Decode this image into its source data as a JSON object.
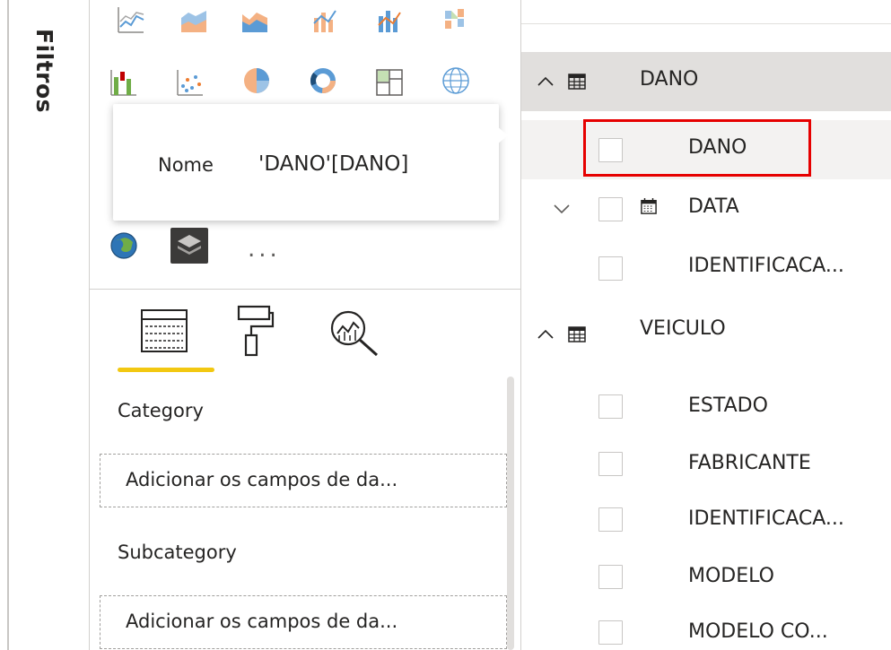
{
  "filters": {
    "label": "Filtros"
  },
  "tooltip": {
    "name_label": "Nome",
    "value": "'DANO'[DANO]"
  },
  "visualizations": {
    "more_label": "...",
    "icons_row1": [
      "line-chart-icon",
      "area-chart-icon",
      "stacked-area-chart-icon",
      "line-column-chart-icon",
      "line-stacked-column-chart-icon",
      "ribbon-chart-icon"
    ],
    "icons_row2": [
      "waterfall-chart-icon",
      "scatter-chart-icon",
      "pie-chart-icon",
      "donut-chart-icon",
      "treemap-icon",
      "map-icon"
    ],
    "icons_row3": [
      "arcgis-map-icon",
      "custom-visual-icon"
    ],
    "tabs": [
      "fields-tab",
      "format-tab",
      "analytics-tab"
    ]
  },
  "wells": [
    {
      "label": "Category",
      "placeholder": "Adicionar os campos de da..."
    },
    {
      "label": "Subcategory",
      "placeholder": "Adicionar os campos de da..."
    }
  ],
  "fields_pane": {
    "tables": [
      {
        "name": "DANO",
        "expanded": true,
        "fields": [
          {
            "name": "DANO",
            "type": "field"
          },
          {
            "name": "DATA",
            "type": "date-hierarchy",
            "expanded": false
          },
          {
            "name": "IDENTIFICACA...",
            "type": "field"
          }
        ]
      },
      {
        "name": "VEICULO",
        "expanded": true,
        "fields": [
          {
            "name": "ESTADO",
            "type": "field"
          },
          {
            "name": "FABRICANTE",
            "type": "field"
          },
          {
            "name": "IDENTIFICACA...",
            "type": "field"
          },
          {
            "name": "MODELO",
            "type": "field"
          },
          {
            "name": "MODELO CO...",
            "type": "field"
          }
        ]
      }
    ]
  },
  "colors": {
    "accent": "#f2c811",
    "highlight": "#e60000",
    "selected_row": "#e1dfdd"
  }
}
